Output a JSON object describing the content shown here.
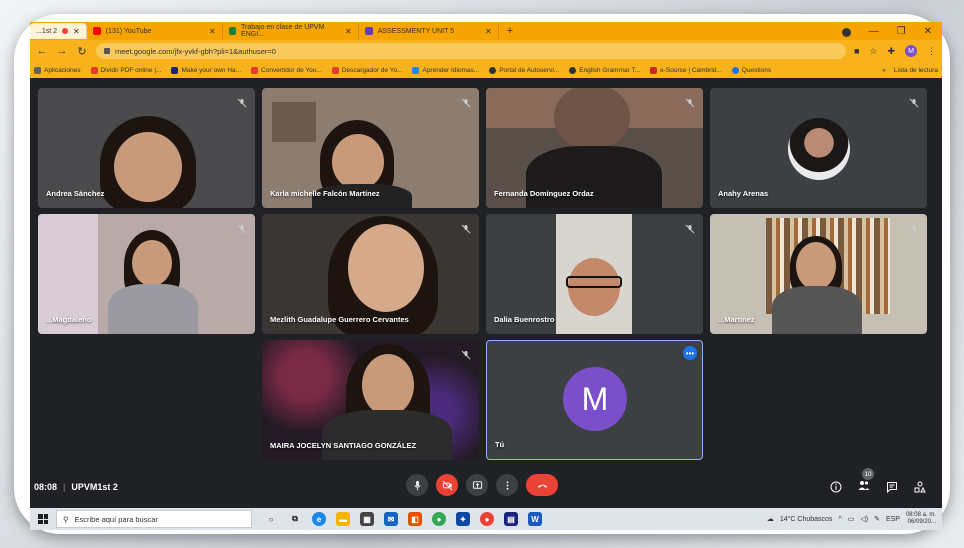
{
  "browser": {
    "tabs": [
      {
        "label": "...1st 2",
        "favicon_color": "#ea4335",
        "active": true
      },
      {
        "label": "(131) YouTube",
        "favicon_color": "#ff0000",
        "active": false
      },
      {
        "label": "Trabajo en clase de UPVM ENGI...",
        "favicon_color": "#188038",
        "active": false
      },
      {
        "label": "ASSESSMENTY UNIT 5",
        "favicon_color": "#673ab7",
        "active": false
      }
    ],
    "url": "meet.google.com/jfx-yvkf-gbh?pli=1&authuser=0",
    "profile_initial": "M",
    "bookmarks": [
      {
        "label": "Aplicaciones",
        "color": "#5f6368"
      },
      {
        "label": "Dividir PDF online |...",
        "color": "#e53935"
      },
      {
        "label": "Make your own Ha...",
        "color": "#1a237e"
      },
      {
        "label": "Convertidor de You...",
        "color": "#e53935"
      },
      {
        "label": "Descargador de Yo...",
        "color": "#e53935"
      },
      {
        "label": "Aprender Idiomas...",
        "color": "#1e88e5"
      },
      {
        "label": "Portal de Autoservi...",
        "color": "#333333"
      },
      {
        "label": "English Grammar T...",
        "color": "#333333"
      },
      {
        "label": "e-Source | Cambrid...",
        "color": "#c62828"
      },
      {
        "label": "Questions",
        "color": "#1a73e8"
      }
    ],
    "bookmarks_more": "»",
    "reading_list": "Lista de lectura"
  },
  "meet": {
    "tiles": [
      {
        "name": "Andrea Sánchez",
        "bg": "#4a4a4c"
      },
      {
        "name": "Karla michelle Falcón Martínez",
        "bg": "#8c7d70"
      },
      {
        "name": "Fernanda Domínguez Ordaz",
        "bg": "#5a4e48"
      },
      {
        "name": "Anahy Arenas",
        "bg": "#3c4043"
      },
      {
        "name": "...Magdaleno",
        "bg": "#b9a9a8"
      },
      {
        "name": "Mezlith Guadalupe Guerrero Cervantes",
        "bg": "#3a3634"
      },
      {
        "name": "Dalia Buenrostro",
        "bg": "#3c4043"
      },
      {
        "name": "...Martínez",
        "bg": "#c6bfb4"
      },
      {
        "name": "MAIRA JOCELYN SANTIAGO GONZÁLEZ",
        "bg": "#241a26"
      },
      {
        "name": "Tú",
        "bg": "#3c4043",
        "avatar": "M"
      }
    ],
    "time": "08:08",
    "meeting_code": "UPVM1st 2",
    "participants_count": "10"
  },
  "taskbar": {
    "search_placeholder": "Escribe aquí para buscar",
    "weather": "14°C  Chubascos",
    "language": "ESP",
    "time": "08:08 a. m.",
    "date": "06/09/20..."
  }
}
